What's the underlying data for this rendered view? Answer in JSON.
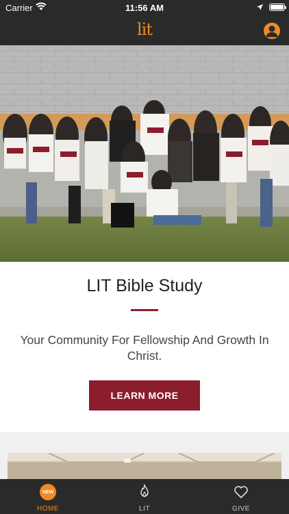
{
  "status_bar": {
    "carrier": "Carrier",
    "time": "11:56 AM"
  },
  "header": {
    "logo_text": "lit",
    "profile_icon": "user-icon"
  },
  "hero": {
    "image_description": "group-photo"
  },
  "main": {
    "title": "LIT Bible Study",
    "subtitle": "Your Community For Fellowship And Growth In Christ.",
    "button_label": "LEARN MORE"
  },
  "tabs": [
    {
      "label": "HOME",
      "icon": "new-badge-icon",
      "badge": "NEW",
      "active": true
    },
    {
      "label": "LIT",
      "icon": "flame-icon",
      "active": false
    },
    {
      "label": "GIVE",
      "icon": "heart-icon",
      "active": false
    }
  ],
  "colors": {
    "accent": "#f08a24",
    "brand": "#8b1d2c",
    "bar_background": "#2a2a2a"
  }
}
